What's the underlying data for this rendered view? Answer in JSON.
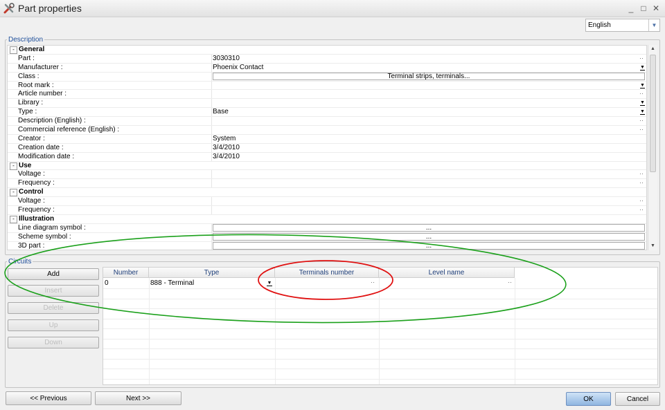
{
  "window": {
    "title": "Part properties"
  },
  "language": {
    "selected": "English"
  },
  "description": {
    "legend": "Description",
    "rows": [
      {
        "type": "category",
        "label": "General"
      },
      {
        "type": "prop",
        "label": "Part :",
        "value": "3030310",
        "control": "ellipsis"
      },
      {
        "type": "prop",
        "label": "Manufacturer :",
        "value": "Phoenix Contact",
        "control": "dropdown"
      },
      {
        "type": "prop",
        "label": "Class :",
        "value": "Terminal strips, terminals...",
        "control": "box"
      },
      {
        "type": "prop",
        "label": "Root mark :",
        "value": "",
        "control": "dropdown"
      },
      {
        "type": "prop",
        "label": "Article number :",
        "value": "",
        "control": "ellipsis"
      },
      {
        "type": "prop",
        "label": "Library :",
        "value": "",
        "control": "dropdown"
      },
      {
        "type": "prop",
        "label": "Type :",
        "value": "Base",
        "control": "dropdown"
      },
      {
        "type": "prop",
        "label": "Description (English) :",
        "value": "",
        "control": "ellipsis"
      },
      {
        "type": "prop",
        "label": "Commercial reference (English) :",
        "value": "",
        "control": "ellipsis"
      },
      {
        "type": "prop",
        "label": "Creator :",
        "value": "System",
        "control": "none"
      },
      {
        "type": "prop",
        "label": "Creation date :",
        "value": "3/4/2010",
        "control": "none"
      },
      {
        "type": "prop",
        "label": "Modification date :",
        "value": "3/4/2010",
        "control": "none"
      },
      {
        "type": "category",
        "label": "Use"
      },
      {
        "type": "prop",
        "label": "Voltage :",
        "value": "",
        "control": "ellipsis"
      },
      {
        "type": "prop",
        "label": "Frequency :",
        "value": "",
        "control": "ellipsis"
      },
      {
        "type": "category",
        "label": "Control"
      },
      {
        "type": "prop",
        "label": "Voltage :",
        "value": "",
        "control": "ellipsis"
      },
      {
        "type": "prop",
        "label": "Frequency :",
        "value": "",
        "control": "ellipsis"
      },
      {
        "type": "category",
        "label": "Illustration"
      },
      {
        "type": "prop",
        "label": "Line diagram symbol :",
        "value": "...",
        "control": "box"
      },
      {
        "type": "prop",
        "label": "Scheme symbol :",
        "value": "...",
        "control": "box"
      },
      {
        "type": "prop",
        "label": "3D part :",
        "value": "...",
        "control": "box"
      }
    ]
  },
  "circuits": {
    "legend": "Circuits",
    "buttons": {
      "add": "Add",
      "insert": "Insert",
      "delete": "Delete",
      "up": "Up",
      "down": "Down"
    },
    "columns": [
      "Number",
      "Type",
      "Terminals number",
      "Level name"
    ],
    "rows": [
      {
        "number": "0",
        "type": "888 - Terminal",
        "terminals": "",
        "level": ""
      }
    ]
  },
  "footer": {
    "previous": "<< Previous",
    "next": "Next >>",
    "ok": "OK",
    "cancel": "Cancel"
  },
  "colors": {
    "annotation_green": "#1aa01a",
    "annotation_red": "#e01010",
    "legend_blue": "#1f4f9a"
  }
}
